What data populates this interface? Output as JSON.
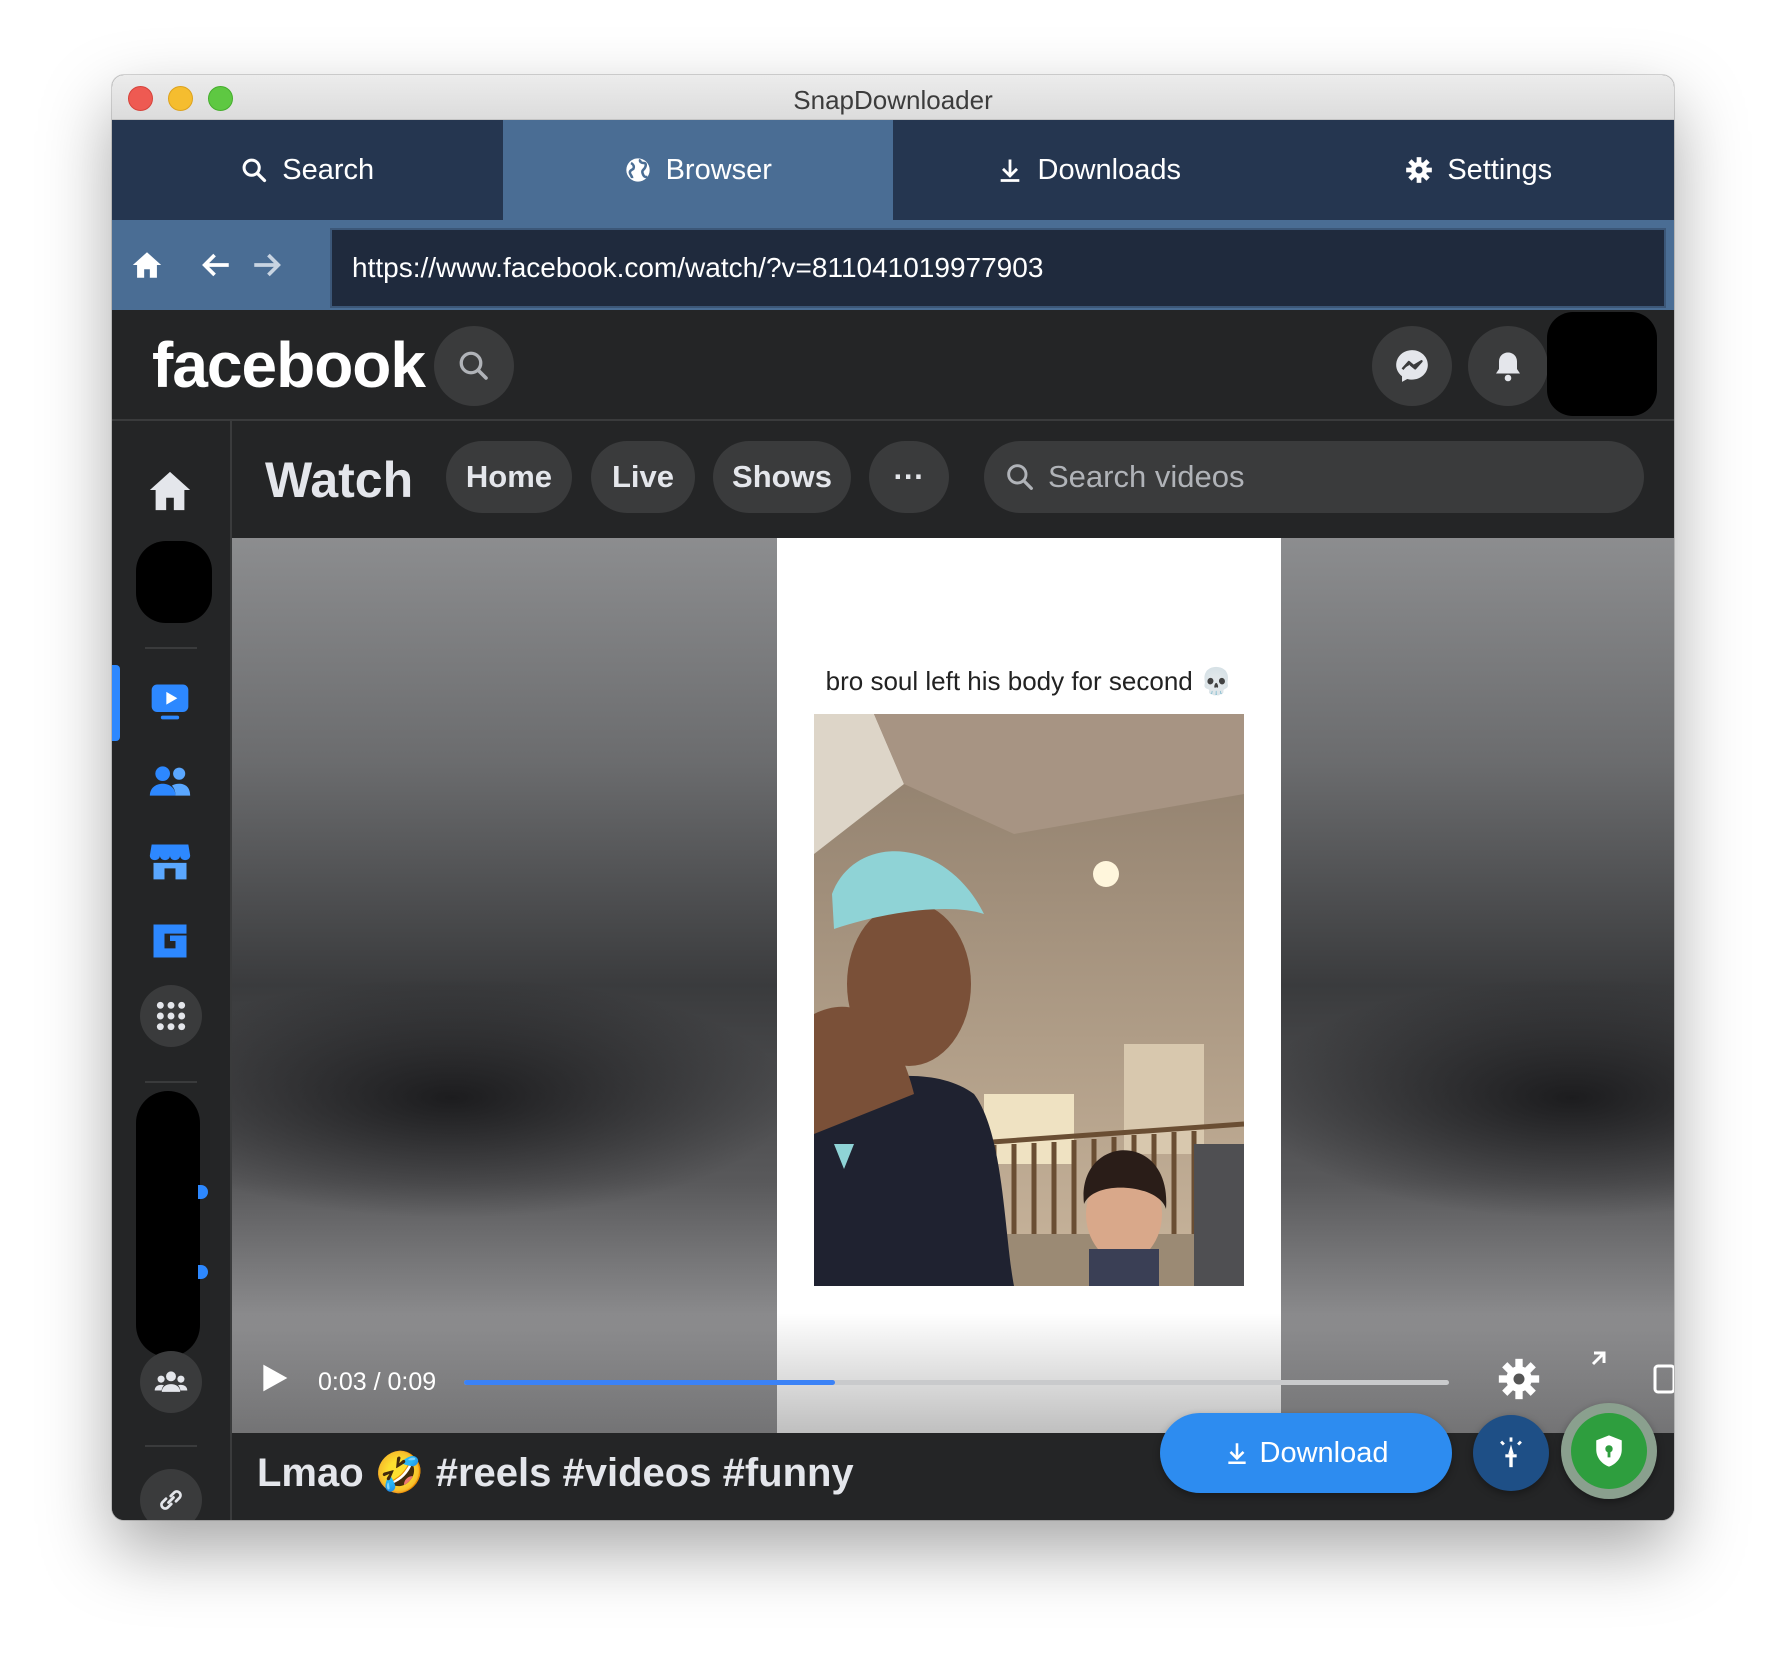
{
  "window": {
    "title": "SnapDownloader"
  },
  "app_tabs": [
    {
      "label": "Search",
      "icon": "search-icon"
    },
    {
      "label": "Browser",
      "icon": "globe-icon",
      "active": true
    },
    {
      "label": "Downloads",
      "icon": "download-icon"
    },
    {
      "label": "Settings",
      "icon": "gear-icon"
    }
  ],
  "browser": {
    "url": "https://www.facebook.com/watch/?v=811041019977903"
  },
  "facebook": {
    "logo": "facebook",
    "watch": {
      "title": "Watch",
      "tabs": [
        "Home",
        "Live",
        "Shows"
      ],
      "more_label": "···",
      "search_placeholder": "Search videos"
    },
    "sidebar_icons": [
      "home-icon",
      "watch-icon",
      "friends-icon",
      "marketplace-icon",
      "gaming-icon",
      "apps-icon",
      "groups-icon",
      "link-icon"
    ]
  },
  "video": {
    "caption": "bro soul left his body for second 💀",
    "current_time": "0:03",
    "duration": "0:09",
    "time_display": "0:03 / 0:09",
    "progress_fraction": 0.377,
    "title": "Lmao 🤣 #reels #videos #funny"
  },
  "actions": {
    "download_label": "Download"
  },
  "colors": {
    "tab_bar": "#253650",
    "active_tab": "#4a6d94",
    "download_button": "#2d8cf0",
    "shield_button": "#2e9e3e",
    "progress": "#3b82f6"
  }
}
